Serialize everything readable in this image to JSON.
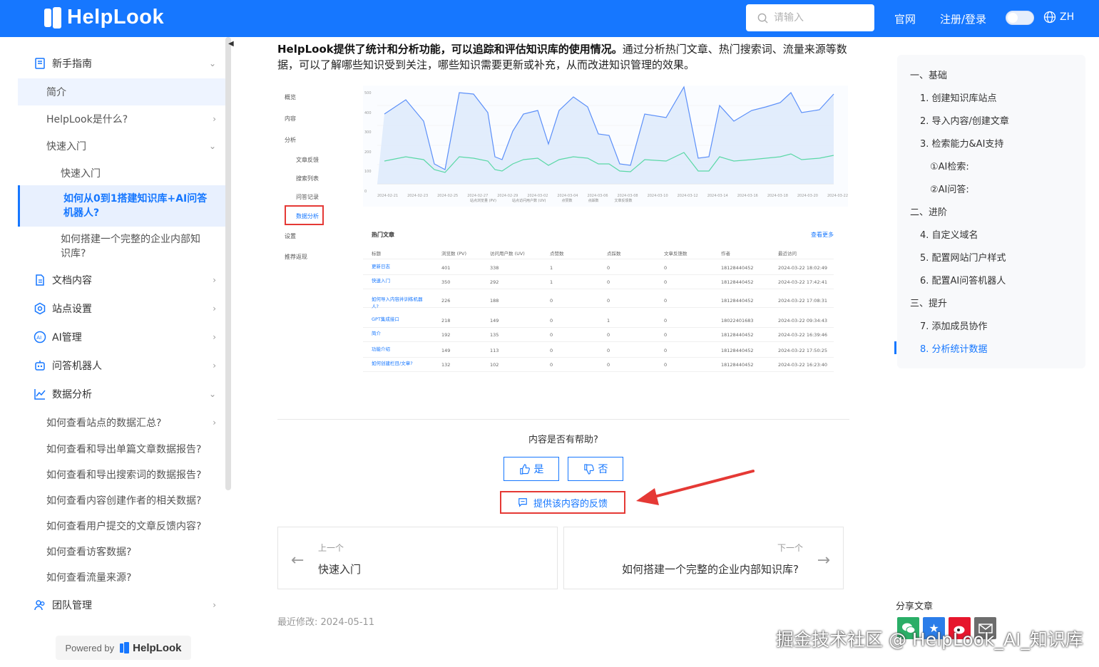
{
  "header": {
    "logo": "HelpLook",
    "search_placeholder": "请输入",
    "nav": [
      "官网",
      "注册/登录"
    ],
    "lang": "ZH",
    "brand_color": "#1677ff"
  },
  "sidebar": {
    "items": [
      {
        "label": "新手指南",
        "icon": "book-icon"
      },
      {
        "label": "简介"
      },
      {
        "label": "HelpLook是什么?"
      },
      {
        "label": "快速入门"
      },
      {
        "label": "快速入门"
      },
      {
        "label": "如何从0到1搭建知识库+AI问答机器人?"
      },
      {
        "label": "如何搭建一个完整的企业内部知识库?"
      },
      {
        "label": "文档内容",
        "icon": "document-icon"
      },
      {
        "label": "站点设置",
        "icon": "gear-icon"
      },
      {
        "label": "AI管理",
        "icon": "ai-icon"
      },
      {
        "label": "问答机器人",
        "icon": "robot-icon"
      },
      {
        "label": "数据分析",
        "icon": "chart-icon"
      },
      {
        "label": "如何查看站点的数据汇总?"
      },
      {
        "label": "如何查看和导出单篇文章数据报告?"
      },
      {
        "label": "如何查看和导出搜索词的数据报告?"
      },
      {
        "label": "如何查看内容创建作者的相关数据?"
      },
      {
        "label": "如何查看用户提交的文章反馈内容?"
      },
      {
        "label": "如何查看访客数据?"
      },
      {
        "label": "如何查看流量来源?"
      },
      {
        "label": "团队管理",
        "icon": "team-icon"
      }
    ],
    "powered_prefix": "Powered by",
    "powered_brand": "HelpLook"
  },
  "main": {
    "intro_bold": "HelpLook提供了统计和分析功能，可以追踪和评估知识库的使用情况。",
    "intro_rest": "通过分析热门文章、热门搜索词、流量来源等数据，可以了解哪些知识受到关注，哪些知识需要更新或补充，从而改进知识管理的效果。",
    "screenshot": {
      "menu": [
        "概览",
        "内容",
        "分析",
        "文章反馈",
        "搜索列表",
        "问答记录",
        "数据分析",
        "设置",
        "推荐返现"
      ],
      "legend": [
        "站点浏览量 (PV)",
        "站点访问用户数 (UV)",
        "点赞数",
        "点踩数",
        "文章反馈数"
      ],
      "x_labels": [
        "2024-02-21",
        "2024-02-23",
        "2024-02-25",
        "2024-02-27",
        "2024-02-29",
        "2024-03-02",
        "2024-03-04",
        "2024-03-06",
        "2024-03-08",
        "2024-03-10",
        "2024-03-12",
        "2024-03-14",
        "2024-03-16",
        "2024-03-18",
        "2024-03-20",
        "2024-03-22"
      ],
      "y_labels": [
        "500",
        "400",
        "300",
        "200",
        "100",
        "0"
      ],
      "table_title": "热门文章",
      "table_more": "查看更多",
      "table_headers": [
        "标题",
        "浏览数 (PV)",
        "访问用户数 (UV)",
        "点赞数",
        "点踩数",
        "文章反馈数",
        "作者",
        "最近访问"
      ],
      "rows": [
        [
          "更新日志",
          "401",
          "338",
          "1",
          "0",
          "0",
          "18128440452",
          "2024-03-22 18:02:49"
        ],
        [
          "快速入门",
          "350",
          "292",
          "1",
          "0",
          "0",
          "18128440452",
          "2024-03-22 17:42:41"
        ],
        [
          "如何导入内容并训练机器人?",
          "226",
          "188",
          "0",
          "0",
          "0",
          "18128440452",
          "2024-03-22 17:08:31"
        ],
        [
          "GPT集成接口",
          "218",
          "149",
          "0",
          "1",
          "0",
          "18022401683",
          "2024-03-22 09:34:43"
        ],
        [
          "简介",
          "192",
          "135",
          "0",
          "0",
          "0",
          "18128440452",
          "2024-03-22 16:39:46"
        ],
        [
          "功能介绍",
          "149",
          "113",
          "0",
          "0",
          "0",
          "18128440452",
          "2024-03-22 17:50:25"
        ],
        [
          "如何创建栏目/文章?",
          "132",
          "102",
          "0",
          "0",
          "0",
          "18128440452",
          "2024-03-22 16:23:40"
        ]
      ]
    },
    "helpful_question": "内容是否有帮助?",
    "yes_label": "是",
    "no_label": "否",
    "feedback_label": "提供该内容的反馈",
    "prev_small": "上一个",
    "prev_title": "快速入门",
    "next_small": "下一个",
    "next_title": "如何搭建一个完整的企业内部知识库?",
    "modified": "最近修改: 2024-05-11",
    "highlight_color": "#e53935"
  },
  "toc": {
    "items": [
      "一、基础",
      "1. 创建知识库站点",
      "2. 导入内容/创建文章",
      "3. 检索能力&AI支持",
      "①AI检索:",
      "②AI问答:",
      "二、进阶",
      "4. 自定义域名",
      "5. 配置网站门户样式",
      "6. 配置AI问答机器人",
      "三、提升",
      "7. 添加成员协作",
      "8. 分析统计数据"
    ],
    "active_index": 12
  },
  "share": {
    "title": "分享文章",
    "icons": [
      "wechat-icon",
      "qzone-icon",
      "weibo-icon",
      "email-icon"
    ]
  },
  "watermark": "掘金技术社区 @ HelpLook_AI_知识库"
}
